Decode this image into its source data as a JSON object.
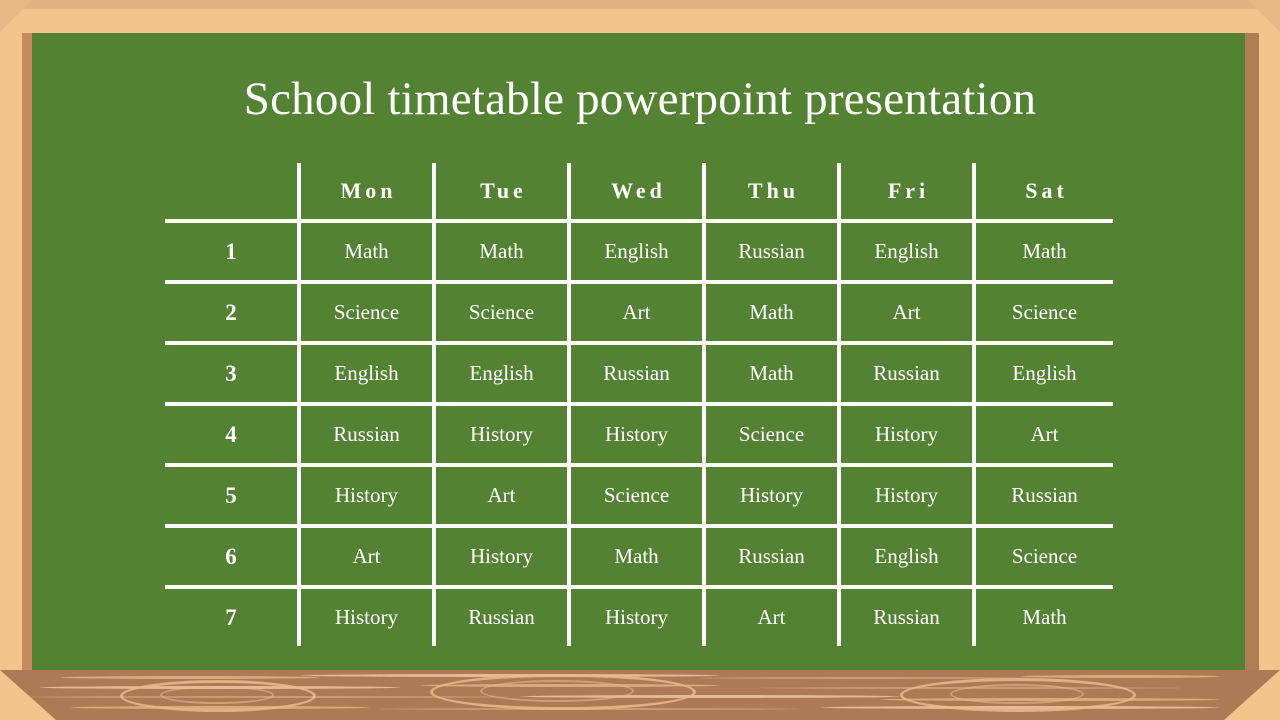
{
  "slide": {
    "title": "School timetable powerpoint presentation",
    "board_color": "#538233",
    "frame_color": "#f4c48c",
    "ledge_color": "#ac7a54",
    "line_color": "#ffffff",
    "text_color": "#ffffff"
  },
  "timetable": {
    "period_header": "",
    "days": [
      "Mon",
      "Tue",
      "Wed",
      "Thu",
      "Fri",
      "Sat"
    ],
    "rows": [
      {
        "period": "1",
        "cells": [
          "Math",
          "Math",
          "English",
          "Russian",
          "English",
          "Math"
        ]
      },
      {
        "period": "2",
        "cells": [
          "Science",
          "Science",
          "Art",
          "Math",
          "Art",
          "Science"
        ]
      },
      {
        "period": "3",
        "cells": [
          "English",
          "English",
          "Russian",
          "Math",
          "Russian",
          "English"
        ]
      },
      {
        "period": "4",
        "cells": [
          "Russian",
          "History",
          "History",
          "Science",
          "History",
          "Art"
        ]
      },
      {
        "period": "5",
        "cells": [
          "History",
          "Art",
          "Science",
          "History",
          "History",
          "Russian"
        ]
      },
      {
        "period": "6",
        "cells": [
          "Art",
          "History",
          "Math",
          "Russian",
          "English",
          "Science"
        ]
      },
      {
        "period": "7",
        "cells": [
          "History",
          "Russian",
          "History",
          "Art",
          "Russian",
          "Math"
        ]
      }
    ]
  }
}
